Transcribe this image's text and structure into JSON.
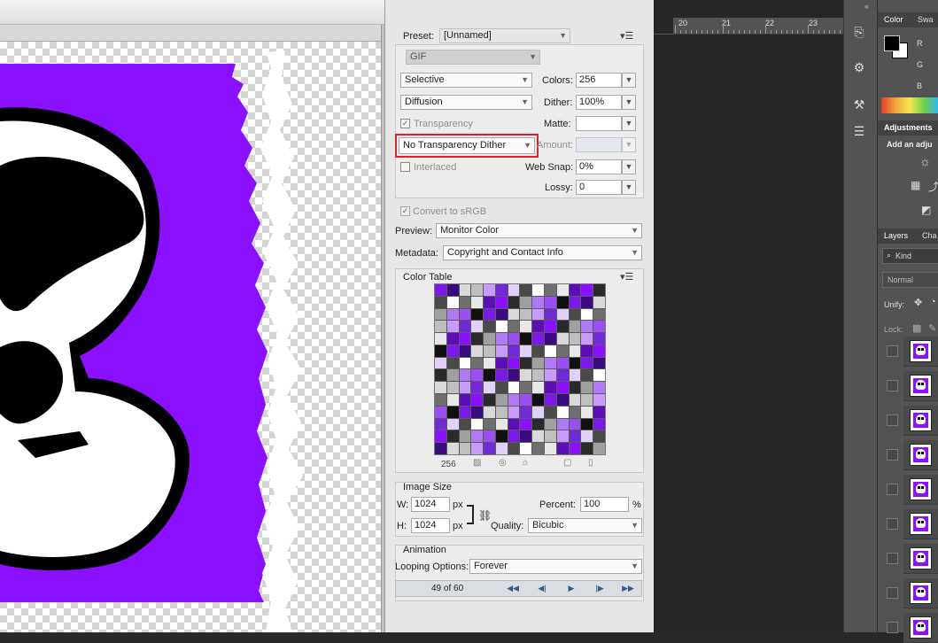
{
  "preset": {
    "label": "Preset:",
    "value": "[Unnamed]"
  },
  "format": {
    "value": "GIF"
  },
  "reduction": {
    "value": "Selective"
  },
  "colors": {
    "label": "Colors:",
    "value": "256"
  },
  "dither_algo": {
    "value": "Diffusion"
  },
  "dither": {
    "label": "Dither:",
    "value": "100%"
  },
  "transparency": {
    "label": "Transparency",
    "checked": true
  },
  "matte": {
    "label": "Matte:",
    "value": ""
  },
  "transparency_dither": {
    "value": "No Transparency Dither"
  },
  "amount": {
    "label": "Amount:",
    "value": ""
  },
  "interlaced": {
    "label": "Interlaced",
    "checked": false
  },
  "web_snap": {
    "label": "Web Snap:",
    "value": "0%"
  },
  "lossy": {
    "label": "Lossy:",
    "value": "0"
  },
  "convert_srgb": {
    "label": "Convert to sRGB",
    "checked": true
  },
  "preview": {
    "label": "Preview:",
    "value": "Monitor Color"
  },
  "metadata": {
    "label": "Metadata:",
    "value": "Copyright and Contact Info"
  },
  "color_table": {
    "title": "Color Table",
    "count": "256",
    "colors": [
      "#7b19e6",
      "#2a2a2a",
      "#ffffff",
      "#bfbfbf",
      "#9b4ff2",
      "#5c0fb5",
      "#e0d0fa",
      "#3b0a80",
      "#a0a0a0",
      "#6f6f6f",
      "#c99cf9",
      "#101010",
      "#8a10ff",
      "#4a4a4a",
      "#d9d9d9",
      "#b07af5",
      "#e8e8e8",
      "#702ad6"
    ]
  },
  "image_size": {
    "title": "Image Size",
    "w_label": "W:",
    "w_value": "1024",
    "h_label": "H:",
    "h_value": "1024",
    "unit": "px",
    "percent_label": "Percent:",
    "percent_value": "100",
    "percent_unit": "%",
    "quality_label": "Quality:",
    "quality_value": "Bicubic"
  },
  "animation": {
    "title": "Animation",
    "looping_label": "Looping Options:",
    "looping_value": "Forever",
    "frame_counter": "49 of 60"
  },
  "ruler": {
    "labels": [
      "20",
      "21",
      "22",
      "23"
    ]
  },
  "panels": {
    "color_tab": "Color",
    "swatches_tab": "Swa",
    "rgb_labels": [
      "R",
      "G",
      "B"
    ],
    "adjustments_title": "Adjustments",
    "adjustments_hint": "Add an adju",
    "layers_tab": "Layers",
    "channels_tab": "Cha",
    "kind_label": "Kind",
    "blend_mode": "Normal",
    "unify_label": "Unify:",
    "lock_label": "Lock:"
  },
  "colors_theme": {
    "accent_highlight": "#e0202a",
    "preview_purple": "#8a10ff"
  }
}
